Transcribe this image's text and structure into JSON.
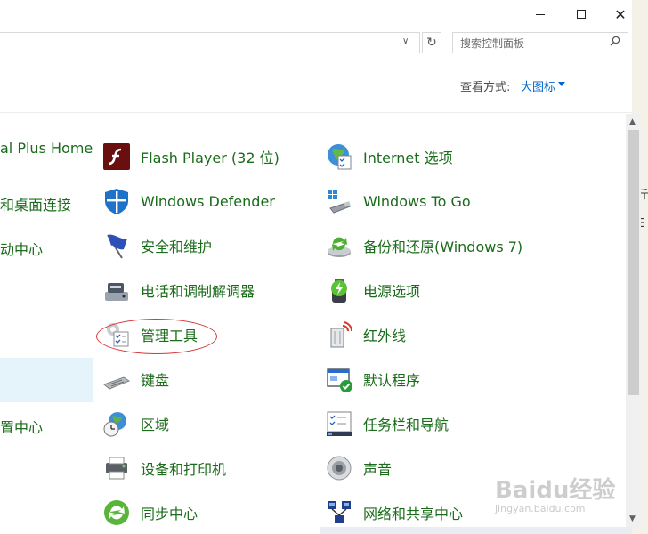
{
  "window": {
    "minimize_glyph": "",
    "close_glyph": "✕"
  },
  "search": {
    "placeholder": "搜索控制面板"
  },
  "view": {
    "label": "查看方式:",
    "value": "大图标"
  },
  "left_fragments": [
    "al Plus Home",
    "和桌面连接",
    "动中心",
    "置中心"
  ],
  "items": [
    {
      "label": "Flash Player (32 位)",
      "icon": "flash-player-icon"
    },
    {
      "label": "Internet 选项",
      "icon": "internet-options-icon"
    },
    {
      "label": "Windows Defender",
      "icon": "windows-defender-icon"
    },
    {
      "label": "Windows To Go",
      "icon": "windows-to-go-icon"
    },
    {
      "label": "安全和维护",
      "icon": "security-maintenance-icon"
    },
    {
      "label": "备份和还原(Windows 7)",
      "icon": "backup-restore-icon"
    },
    {
      "label": "电话和调制解调器",
      "icon": "phone-modem-icon"
    },
    {
      "label": "电源选项",
      "icon": "power-options-icon"
    },
    {
      "label": "管理工具",
      "icon": "administrative-tools-icon"
    },
    {
      "label": "红外线",
      "icon": "infrared-icon"
    },
    {
      "label": "键盘",
      "icon": "keyboard-icon"
    },
    {
      "label": "默认程序",
      "icon": "default-programs-icon"
    },
    {
      "label": "区域",
      "icon": "region-icon"
    },
    {
      "label": "任务栏和导航",
      "icon": "taskbar-navigation-icon"
    },
    {
      "label": "设备和打印机",
      "icon": "devices-printers-icon"
    },
    {
      "label": "声音",
      "icon": "sound-icon"
    },
    {
      "label": "同步中心",
      "icon": "sync-center-icon"
    },
    {
      "label": "网络和共享中心",
      "icon": "network-sharing-icon"
    }
  ],
  "outer_fragments": [
    "斤",
    "E"
  ],
  "watermark": {
    "main": "Baidu经验",
    "sub": "jingyan.baidu.com"
  },
  "colors": {
    "link_green": "#1a6b1a",
    "accent_blue": "#0066cc",
    "annotation_red": "#d43a3a",
    "selection": "#e5f3fb"
  }
}
